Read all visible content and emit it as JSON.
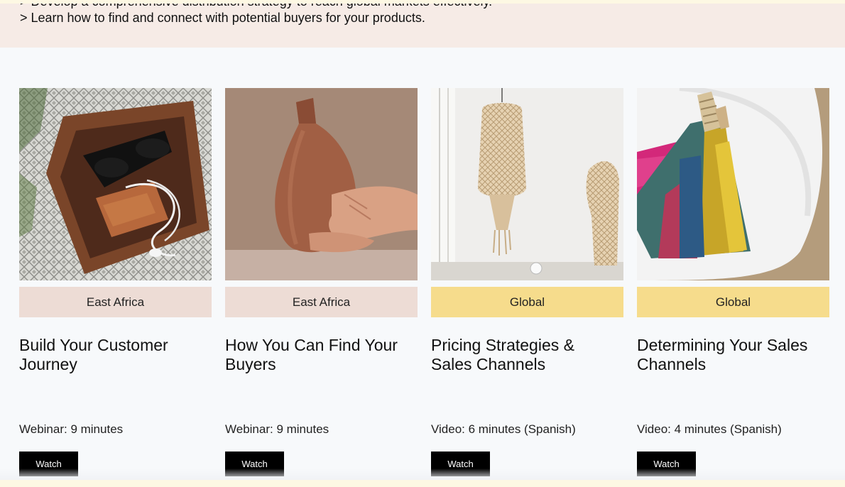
{
  "intro": {
    "line1": "> Develop a comprehensive distribution strategy to reach global markets effectively.",
    "line2": "> Learn how to find and connect with potential buyers for your products."
  },
  "cards": [
    {
      "image_alt": "leather tray with sunglasses and earphones",
      "region": "East Africa",
      "title": "Build Your Customer Journey",
      "meta": "Webinar: 9 minutes",
      "button": "Watch"
    },
    {
      "image_alt": "hands holding a terracotta vase",
      "region": "East Africa",
      "title": "How You Can Find Your Buyers",
      "meta": "Webinar: 9 minutes",
      "button": "Watch"
    },
    {
      "image_alt": "woven rattan pendant lamp and chair",
      "region": "Global",
      "title": "Pricing Strategies & Sales Channels",
      "meta": "Video: 6 minutes (Spanish)",
      "button": "Watch"
    },
    {
      "image_alt": "colorful woven straw brush on white bowl",
      "region": "Global",
      "title": "Determining Your Sales Channels",
      "meta": "Video: 4 minutes (Spanish)",
      "button": "Watch"
    }
  ],
  "colors": {
    "east_africa_tag": "#eddcd5",
    "global_tag": "#f6dc8c",
    "button_bg": "#000000",
    "intro_bg": "#f6ebe6"
  }
}
